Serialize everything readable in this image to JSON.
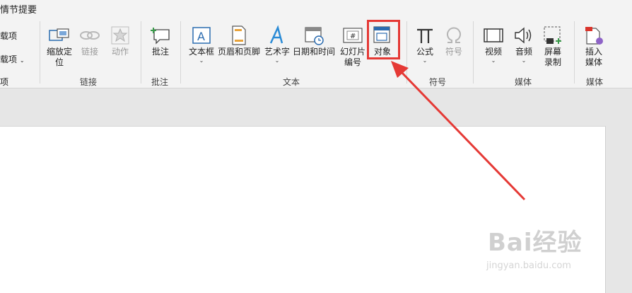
{
  "ribbon": {
    "partial_title": "情节提要",
    "left_items": [
      "载项",
      "载项",
      "项"
    ],
    "groups": {
      "links": "链接",
      "comments": "批注",
      "text": "文本",
      "symbols": "符号",
      "media": "媒体",
      "media2": "媒体"
    },
    "buttons": {
      "zoom": "缩放定\n位",
      "link": "链接",
      "action": "动作",
      "comment": "批注",
      "textbox": "文本框",
      "header_footer": "页眉和页脚",
      "wordart": "艺术字",
      "datetime": "日期和时间",
      "slide_number": "幻灯片\n编号",
      "object": "对象",
      "equation": "公式",
      "symbol": "符号",
      "video": "视频",
      "audio": "音频",
      "screen_record": "屏幕\n录制",
      "insert_media": "插入\n媒体"
    }
  },
  "watermark": {
    "brand": "Bai经验",
    "url": "jingyan.baidu.com"
  },
  "colors": {
    "accent_blue": "#2b6cb0",
    "highlight_red": "#e53935",
    "green": "#3a9a4a"
  }
}
